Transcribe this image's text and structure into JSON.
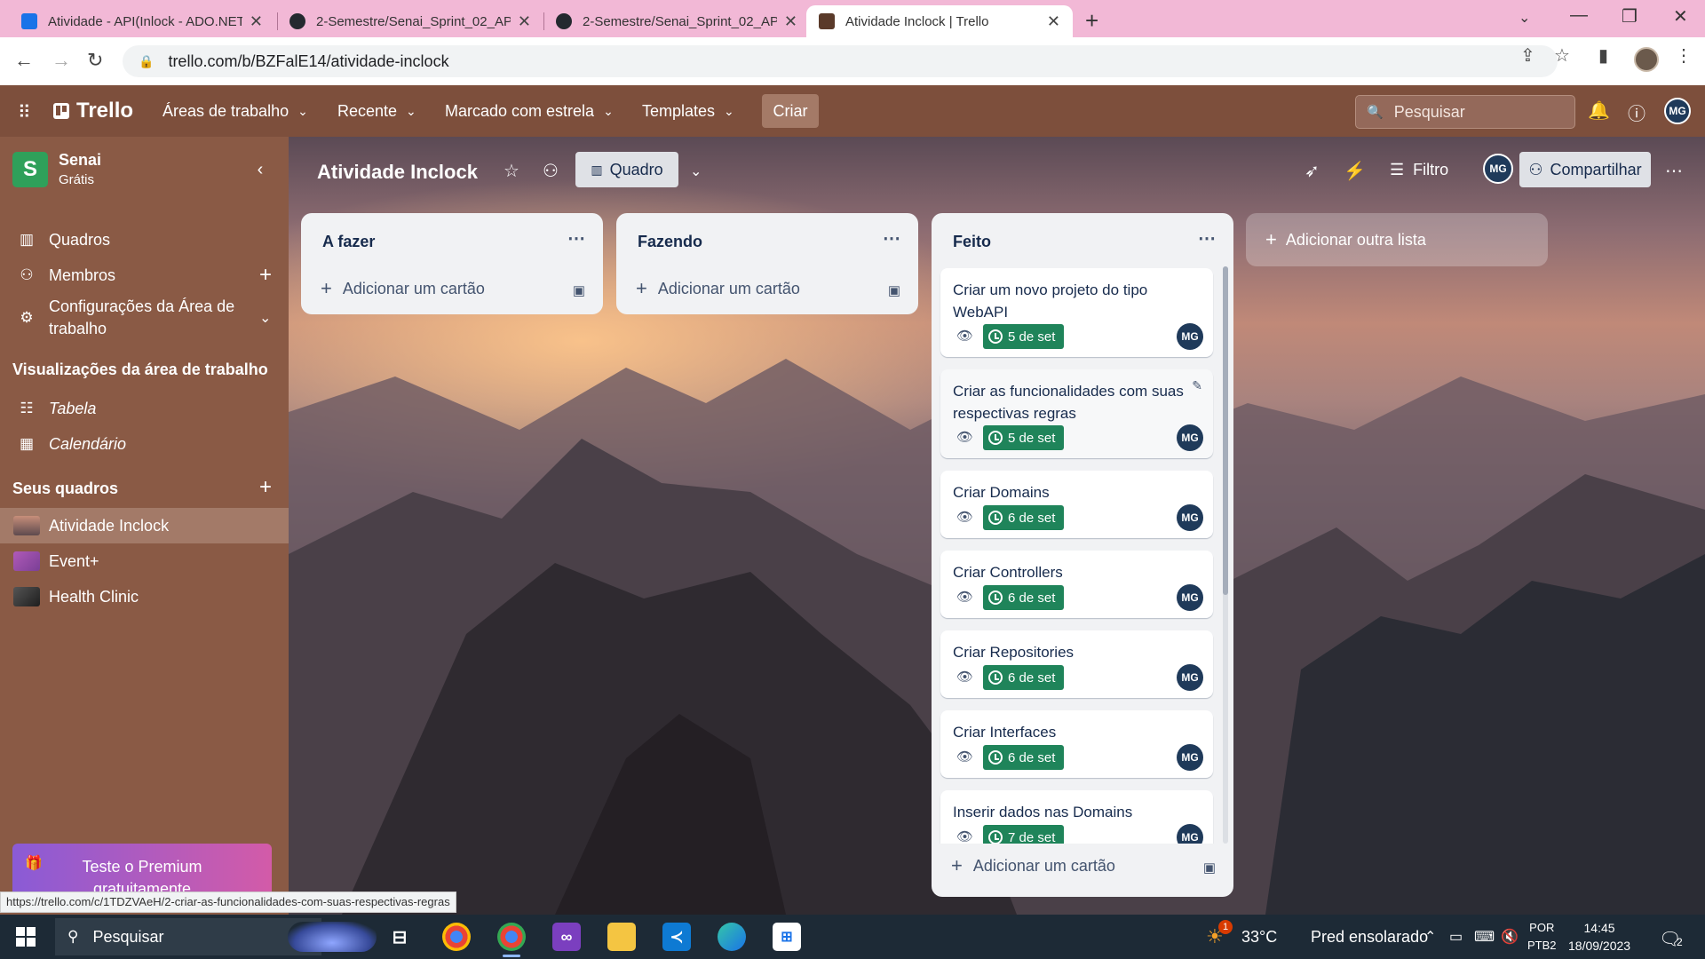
{
  "browser": {
    "tabs": [
      {
        "title": "Atividade - API(Inlock - ADO.NET",
        "favicon_color": "#1a73e8"
      },
      {
        "title": "2-Semestre/Senai_Sprint_02_API/",
        "favicon_color": "#24292f"
      },
      {
        "title": "2-Semestre/Senai_Sprint_02_API/",
        "favicon_color": "#24292f"
      },
      {
        "title": "Atividade Inclock | Trello",
        "favicon_color": "#5a3a2a"
      }
    ],
    "url": "trello.com/b/BZFalE14/atividade-inclock",
    "status_url": "https://trello.com/c/1TDZVAeH/2-criar-as-funcionalidades-com-suas-respectivas-regras"
  },
  "trello_header": {
    "logo": "Trello",
    "menus": [
      "Áreas de trabalho",
      "Recente",
      "Marcado com estrela",
      "Templates"
    ],
    "create_label": "Criar",
    "search_placeholder": "Pesquisar",
    "user_initials": "MG"
  },
  "sidebar": {
    "workspace_initial": "S",
    "workspace_name": "Senai",
    "workspace_plan": "Grátis",
    "items": [
      {
        "label": "Quadros",
        "icon": "board-icon"
      },
      {
        "label": "Membros",
        "icon": "person-icon"
      },
      {
        "label": "Configurações da Área de trabalho",
        "icon": "gear-icon"
      }
    ],
    "views_header": "Visualizações da área de trabalho",
    "views": [
      {
        "label": "Tabela",
        "icon": "table-icon"
      },
      {
        "label": "Calendário",
        "icon": "calendar-icon"
      }
    ],
    "boards_header": "Seus quadros",
    "boards": [
      {
        "label": "Atividade Inclock",
        "thumb": "#9a6a58",
        "active": true
      },
      {
        "label": "Event+",
        "thumb": "#9a4fa8",
        "active": false
      },
      {
        "label": "Health Clinic",
        "thumb": "#3a3a3a",
        "active": false
      }
    ],
    "premium_label": "Teste o Premium gratuitamente"
  },
  "board": {
    "title": "Atividade Inclock",
    "view_label": "Quadro",
    "filter_label": "Filtro",
    "member_initials": "MG",
    "share_label": "Compartilhar",
    "add_list_label": "Adicionar outra lista",
    "lists": [
      {
        "title": "A fazer",
        "add_card_label": "Adicionar um cartão"
      },
      {
        "title": "Fazendo",
        "add_card_label": "Adicionar um cartão"
      },
      {
        "title": "Feito",
        "add_card_label": "Adicionar um cartão"
      }
    ],
    "done_cards": [
      {
        "title": "Criar um novo projeto do tipo WebAPI",
        "due": "5 de set",
        "member": "MG"
      },
      {
        "title": "Criar as funcionalidades com suas respectivas regras",
        "due": "5 de set",
        "member": "MG"
      },
      {
        "title": "Criar Domains",
        "due": "6 de set",
        "member": "MG"
      },
      {
        "title": "Criar Controllers",
        "due": "6 de set",
        "member": "MG"
      },
      {
        "title": "Criar Repositories",
        "due": "6 de set",
        "member": "MG"
      },
      {
        "title": "Criar Interfaces",
        "due": "6 de set",
        "member": "MG"
      },
      {
        "title": "Inserir dados nas Domains",
        "due": "7 de set",
        "member": "MG"
      }
    ]
  },
  "taskbar": {
    "search_placeholder": "Pesquisar",
    "weather_temp": "33°C",
    "weather_text": "Pred ensolarado",
    "weather_badge": "1",
    "lang_top": "POR",
    "lang_bottom": "PTB2",
    "time": "14:45",
    "date": "18/09/2023",
    "notif_count": "2"
  }
}
